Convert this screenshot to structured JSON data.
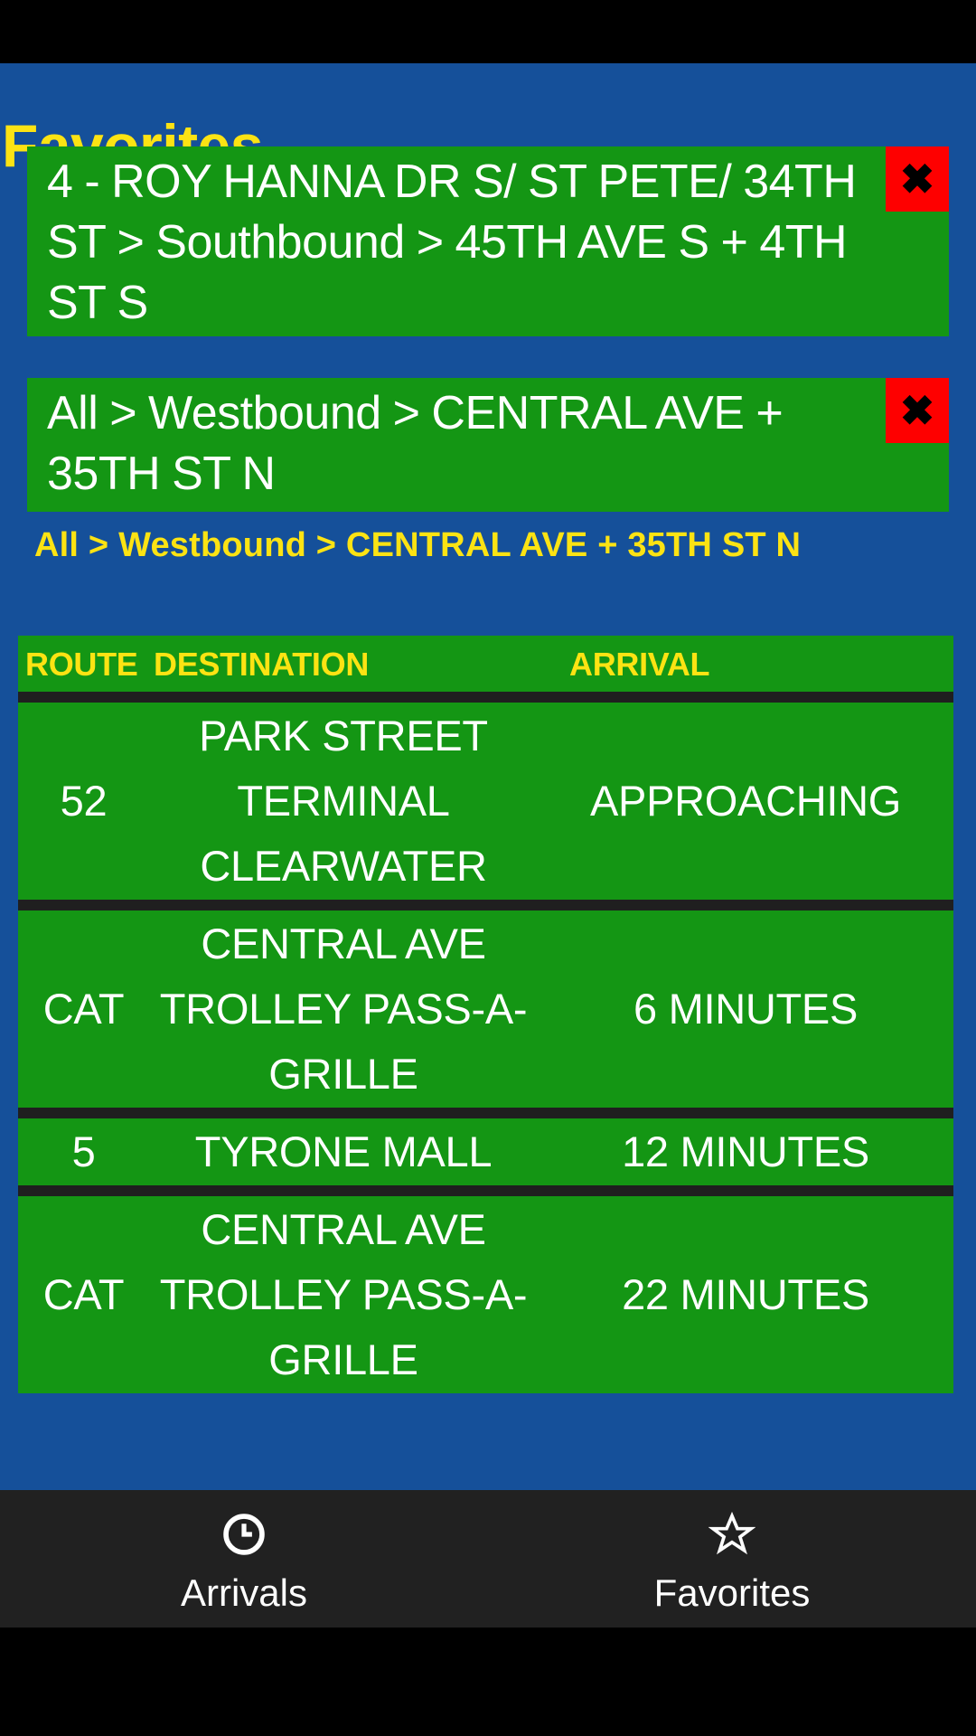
{
  "app": {
    "title": "Favorites"
  },
  "favorites": [
    {
      "label": "4 - ROY HANNA DR S/ ST PETE/ 34TH ST > Southbound > 45TH AVE S + 4TH ST S",
      "delete_label": "✖"
    },
    {
      "label": "All > Westbound > CENTRAL AVE + 35TH ST N",
      "delete_label": "✖"
    }
  ],
  "breadcrumb": "All > Westbound > CENTRAL AVE + 35TH ST N",
  "table": {
    "headers": {
      "route": "ROUTE",
      "destination": "DESTINATION",
      "arrival": "ARRIVAL"
    },
    "rows": [
      {
        "route": "52",
        "destination": "PARK STREET TERMINAL CLEARWATER",
        "arrival": "APPROACHING"
      },
      {
        "route": "CAT",
        "destination": "CENTRAL AVE TROLLEY PASS-A-GRILLE",
        "arrival": "6 MINUTES"
      },
      {
        "route": "5",
        "destination": "TYRONE MALL",
        "arrival": "12 MINUTES"
      },
      {
        "route": "CAT",
        "destination": "CENTRAL AVE TROLLEY PASS-A-GRILLE",
        "arrival": "22 MINUTES"
      }
    ]
  },
  "bottom_nav": {
    "items": [
      {
        "label": "Arrivals",
        "icon": "clock-icon"
      },
      {
        "label": "Favorites",
        "icon": "star-icon"
      }
    ]
  },
  "colors": {
    "background_blue": "#15509A",
    "card_green": "#149614",
    "accent_yellow": "#FCE313",
    "delete_red": "#FE0000",
    "separator_dark": "#1F1F1F",
    "nav_bar": "#212121",
    "text_white": "#FFFFFF"
  }
}
